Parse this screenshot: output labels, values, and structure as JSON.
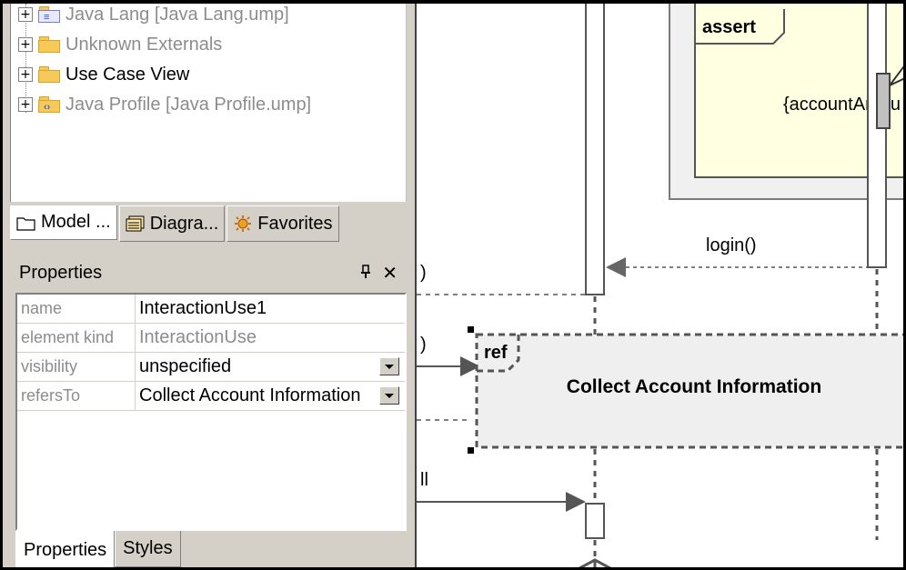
{
  "tree": {
    "items": [
      {
        "label": "Java Lang [Java Lang.ump]",
        "style": "gray"
      },
      {
        "label": "Unknown Externals",
        "style": "gray"
      },
      {
        "label": "Use Case View",
        "style": "normal"
      },
      {
        "label": "Java Profile [Java Profile.ump]",
        "style": "gray"
      }
    ]
  },
  "browser_tabs": [
    {
      "label": "Model ...",
      "icon": "folder-icon"
    },
    {
      "label": "Diagra...",
      "icon": "diagram-icon"
    },
    {
      "label": "Favorites",
      "icon": "favorites-icon"
    }
  ],
  "properties_panel": {
    "title": "Properties",
    "pin_glyph": "ᵖ",
    "close_glyph": "✕",
    "rows": [
      {
        "key": "name",
        "value": "InteractionUse1",
        "value_style": "normal",
        "dropdown": false
      },
      {
        "key": "element kind",
        "value": "InteractionUse",
        "value_style": "gray",
        "dropdown": false
      },
      {
        "key": "visibility",
        "value": "unspecified",
        "value_style": "normal",
        "dropdown": true
      },
      {
        "key": "refersTo",
        "value": "Collect Account Information",
        "value_style": "normal",
        "dropdown": true
      }
    ],
    "tabs": [
      {
        "label": "Properties",
        "active": true
      },
      {
        "label": "Styles",
        "active": false
      }
    ]
  },
  "diagram": {
    "assert_label": "assert",
    "constraint_text": "{accountAmou",
    "login_message": "login()",
    "ref_tag": "ref",
    "ref_title": "Collect Account Information",
    "clipped_left_1": ")",
    "clipped_left_2": ")",
    "clipped_left_3": "ll"
  },
  "colors": {
    "panel_bg": "#d4d0c8",
    "fragment_fill": "#ffffe1",
    "ref_fill": "#f0f0f0",
    "folder": "#f7c95a"
  }
}
